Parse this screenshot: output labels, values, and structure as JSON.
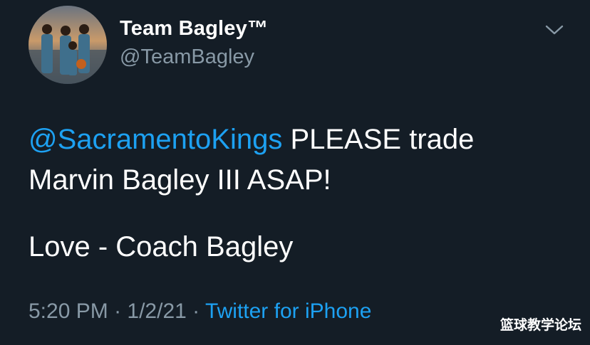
{
  "profile": {
    "display_name": "Team Bagley™",
    "handle": "@TeamBagley",
    "menu_icon": "chevron-down-icon"
  },
  "tweet": {
    "mention": "@SacramentoKings",
    "line1_rest": " PLEASE trade",
    "line2": "Marvin Bagley III ASAP!",
    "line3": "Love - Coach Bagley"
  },
  "meta": {
    "time": "5:20 PM",
    "separator1": " · ",
    "date": "1/2/21",
    "separator2": " · ",
    "source": "Twitter for iPhone"
  },
  "watermark": {
    "text": "篮球教学论坛"
  },
  "colors": {
    "background": "#141d26",
    "link": "#1da1f2",
    "secondary_text": "#8899a6"
  }
}
